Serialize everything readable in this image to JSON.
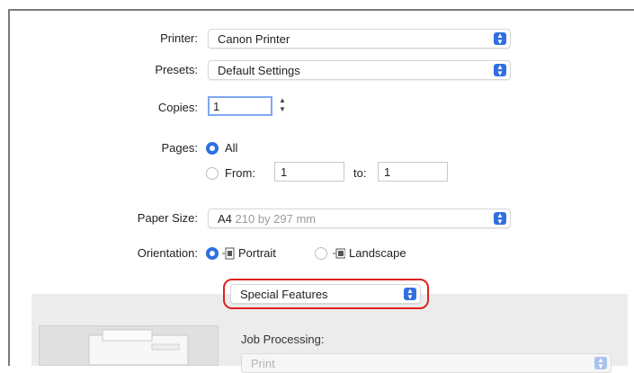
{
  "printer": {
    "label": "Printer:",
    "value": "Canon Printer"
  },
  "presets": {
    "label": "Presets:",
    "value": "Default Settings"
  },
  "copies": {
    "label": "Copies:",
    "value": "1"
  },
  "pages": {
    "label": "Pages:",
    "all_label": "All",
    "from_label": "From:",
    "from_value": "1",
    "to_label": "to:",
    "to_value": "1"
  },
  "paper_size": {
    "label": "Paper Size:",
    "size": "A4",
    "dims": "210 by 297 mm"
  },
  "orientation": {
    "label": "Orientation:",
    "portrait": "Portrait",
    "landscape": "Landscape"
  },
  "section_popup": {
    "value": "Special Features",
    "highlight_color": "#e02020"
  },
  "job_processing": {
    "label": "Job Processing:",
    "value": "Print"
  },
  "colors": {
    "accent": "#2f6fe0",
    "panel": "#ececec"
  }
}
